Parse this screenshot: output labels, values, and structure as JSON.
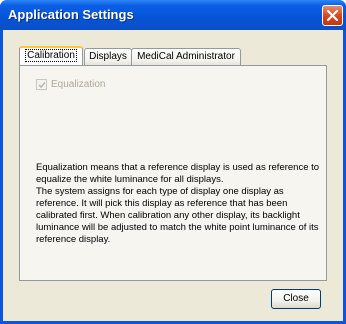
{
  "window": {
    "title": "Application Settings"
  },
  "tabs": [
    {
      "label": "Calibration",
      "selected": true
    },
    {
      "label": "Displays",
      "selected": false
    },
    {
      "label": "MediCal Administrator",
      "selected": false
    }
  ],
  "calibration": {
    "equalization_label": "Equalization",
    "equalization_checked": true,
    "equalization_enabled": false,
    "description": [
      "Equalization means that a reference display is used as reference to equalize the white luminance for all displays.",
      "The system assigns for each type of display one display as reference. It will pick this display as reference that has been calibrated first. When calibration any other display, its backlight luminance will be adjusted to match the white point luminance of its reference display."
    ]
  },
  "footer": {
    "close_label": "Close"
  },
  "colors": {
    "titlebar": "#0a5fe6",
    "close_icon_bg": "#d5431c",
    "client_bg": "#ece9d8",
    "active_tab_accent": "#ffc83c"
  },
  "icons": {
    "window_close": "close-icon",
    "checkbox_mark": "checkmark-icon"
  }
}
